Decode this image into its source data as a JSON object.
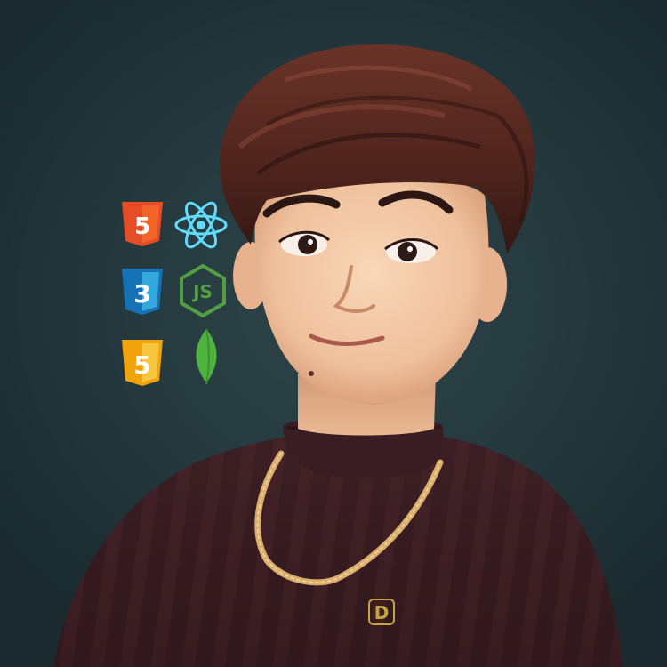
{
  "avatar": {
    "shirt_monogram": "D"
  },
  "tech_icons": [
    {
      "name": "html5-icon",
      "glyph": "5",
      "color": "#e44d26"
    },
    {
      "name": "react-icon",
      "color": "#61dafb"
    },
    {
      "name": "css3-icon",
      "glyph": "3",
      "color": "#2965f1"
    },
    {
      "name": "nodejs-icon",
      "glyph": "JS",
      "color": "#3c873a"
    },
    {
      "name": "javascript-icon",
      "glyph": "5",
      "color": "#f0a30a"
    },
    {
      "name": "mongodb-icon",
      "color": "#4db33d"
    }
  ],
  "colors": {
    "background": "#24393e",
    "hair": "#5a2a22",
    "skin": "#f2c9a8",
    "shirt": "#3b1f24",
    "chain": "#d8b070"
  }
}
